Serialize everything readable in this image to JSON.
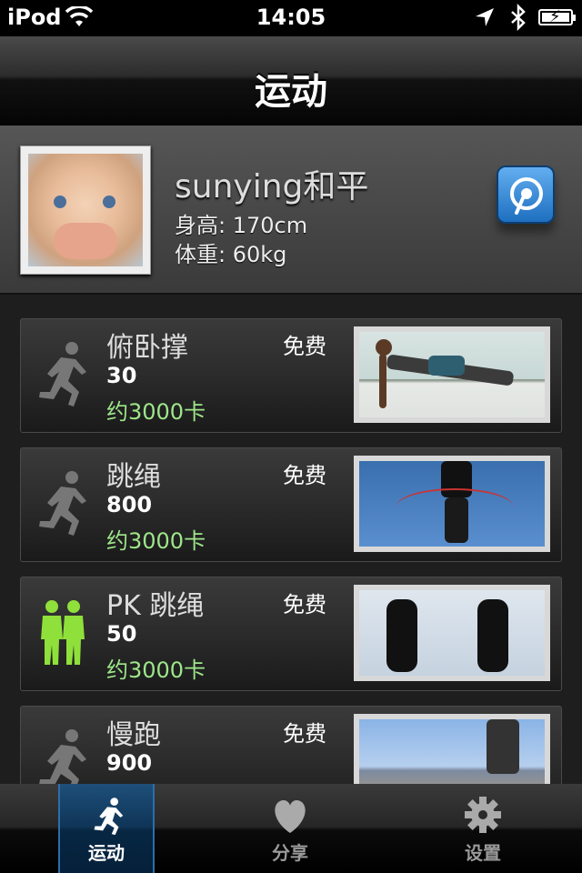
{
  "status_bar": {
    "carrier": "iPod",
    "time": "14:05"
  },
  "nav": {
    "title": "运动"
  },
  "profile": {
    "name": "sunying和平",
    "height": "身高: 170cm",
    "weight": "体重: 60kg"
  },
  "exercises": [
    {
      "title": "俯卧撑",
      "price": "免费",
      "count": "30",
      "calories": "约3000卡",
      "icon": "runner-icon"
    },
    {
      "title": "跳绳",
      "price": "免费",
      "count": "800",
      "calories": "约3000卡",
      "icon": "runner-icon"
    },
    {
      "title": "PK 跳绳",
      "price": "免费",
      "count": "50",
      "calories": "约3000卡",
      "icon": "pk-players-icon"
    },
    {
      "title": "慢跑",
      "price": "免费",
      "count": "900",
      "calories": "",
      "icon": "runner-icon"
    }
  ],
  "tabs": [
    {
      "label": "运动",
      "icon": "runner-icon",
      "active": true
    },
    {
      "label": "分享",
      "icon": "heart-icon",
      "active": false
    },
    {
      "label": "设置",
      "icon": "gear-icon",
      "active": false
    }
  ],
  "colors": {
    "calories": "#9ee68a",
    "active_tab": "#0f3557",
    "bt_button": "#1e6fc0",
    "pk_icon": "#8fe03a"
  }
}
